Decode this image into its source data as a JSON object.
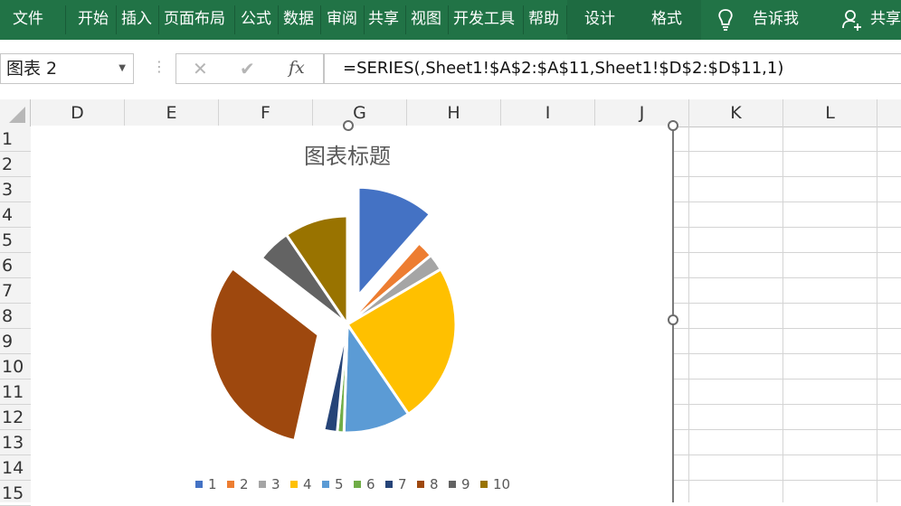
{
  "ribbon": {
    "tabs": [
      "文件",
      "开始",
      "插入",
      "页面布局",
      "公式",
      "数据",
      "审阅",
      "共享",
      "视图",
      "开发工具",
      "帮助"
    ],
    "context_tabs": [
      "设计",
      "格式"
    ],
    "tell_me": "告诉我",
    "share": "共享",
    "bg_color": "#217346"
  },
  "formula_bar": {
    "name_box": "图表 2",
    "formula": "=SERIES(,Sheet1!$A$2:$A$11,Sheet1!$D$2:$D$11,1)",
    "cancel_icon": "✕",
    "confirm_icon": "✔",
    "fx_label": "fx"
  },
  "columns": [
    "D",
    "E",
    "F",
    "G",
    "H",
    "I",
    "J",
    "K",
    "L"
  ],
  "rows": [
    "1",
    "2",
    "3",
    "4",
    "5",
    "6",
    "7",
    "8",
    "9",
    "10",
    "11",
    "12",
    "13",
    "14",
    "15"
  ],
  "chart": {
    "title": "图表标题"
  },
  "chart_data": {
    "type": "pie",
    "title": "图表标题",
    "categories": [
      "1",
      "2",
      "3",
      "4",
      "5",
      "6",
      "7",
      "8",
      "9",
      "10"
    ],
    "values": [
      11.5,
      2.5,
      2.5,
      24,
      10,
      1,
      2,
      32,
      5,
      9.5
    ],
    "exploded_slices": [
      "1",
      "8"
    ],
    "colors": [
      "#4472c4",
      "#ed7d31",
      "#a5a5a5",
      "#ffc000",
      "#5b9bd5",
      "#70ad47",
      "#264478",
      "#9e480e",
      "#636363",
      "#997300"
    ],
    "legend_position": "bottom"
  }
}
